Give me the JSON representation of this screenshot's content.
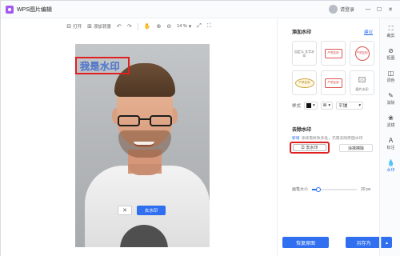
{
  "app": {
    "title": "WPS图片编辑",
    "login": "请登录"
  },
  "toolbar": {
    "open": "打开",
    "add_background": "添加背景",
    "zoom": "14 %"
  },
  "canvas": {
    "watermark_text": "我是水印",
    "cancel_label": "✕",
    "remove_label": "去水印"
  },
  "panel": {
    "add_watermark": {
      "title": "添加水印",
      "help": "建议",
      "cards": [
        {
          "label": "自定义\n文字水印"
        },
        {
          "label": "严禁复制"
        },
        {
          "label": "严禁复制"
        },
        {
          "label": "严禁复制"
        },
        {
          "label": "严禁复制"
        },
        {
          "label": "图片水印"
        }
      ],
      "style_label": "样式",
      "tile_label": "平铺"
    },
    "remove_watermark": {
      "title": "去除水印",
      "info_new": "新增",
      "info_text": "涂抹需修改多处，无需去除原图水印",
      "smart_label": "去水印 ",
      "brush_label": "涂抹擦除",
      "brush_size_label": "画笔大小",
      "brush_size_value": "20 px",
      "brush_size_fraction": 0.14
    },
    "restore_label": "恢复原图",
    "saveas_label": "另存为"
  },
  "rail": [
    {
      "label": "裁剪",
      "icon": "crop-icon"
    },
    {
      "label": "抠图",
      "icon": "cutout-icon"
    },
    {
      "label": "调色",
      "icon": "adjust-icon"
    },
    {
      "label": "消除",
      "icon": "eraser-icon"
    },
    {
      "label": "滤镜",
      "icon": "filter-icon"
    },
    {
      "label": "标注",
      "icon": "annotate-icon"
    },
    {
      "label": "水印",
      "icon": "watermark-icon"
    }
  ]
}
